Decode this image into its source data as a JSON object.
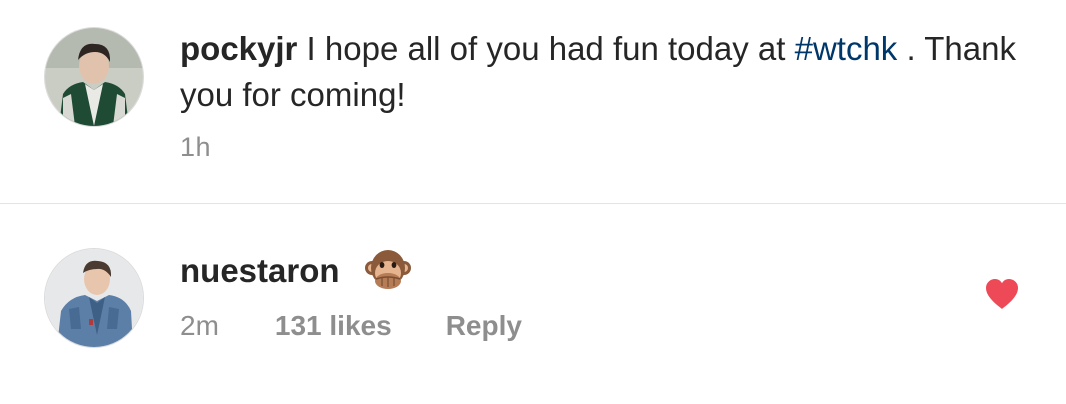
{
  "post": {
    "author": "pockyjr",
    "caption_before": " I hope all of you had fun today at ",
    "hashtag": "#wtchk",
    "caption_after": " . Thank you for coming!",
    "time": "1h"
  },
  "comment": {
    "author": "nuestaron",
    "emoji": "speak-no-evil-monkey-icon",
    "time": "2m",
    "likes": "131 likes",
    "reply_label": "Reply",
    "liked": true
  },
  "colors": {
    "text": "#262626",
    "muted": "#8e8e8e",
    "hashtag": "#00376b",
    "heart": "#ed4956",
    "divider": "#e3e3e3"
  }
}
